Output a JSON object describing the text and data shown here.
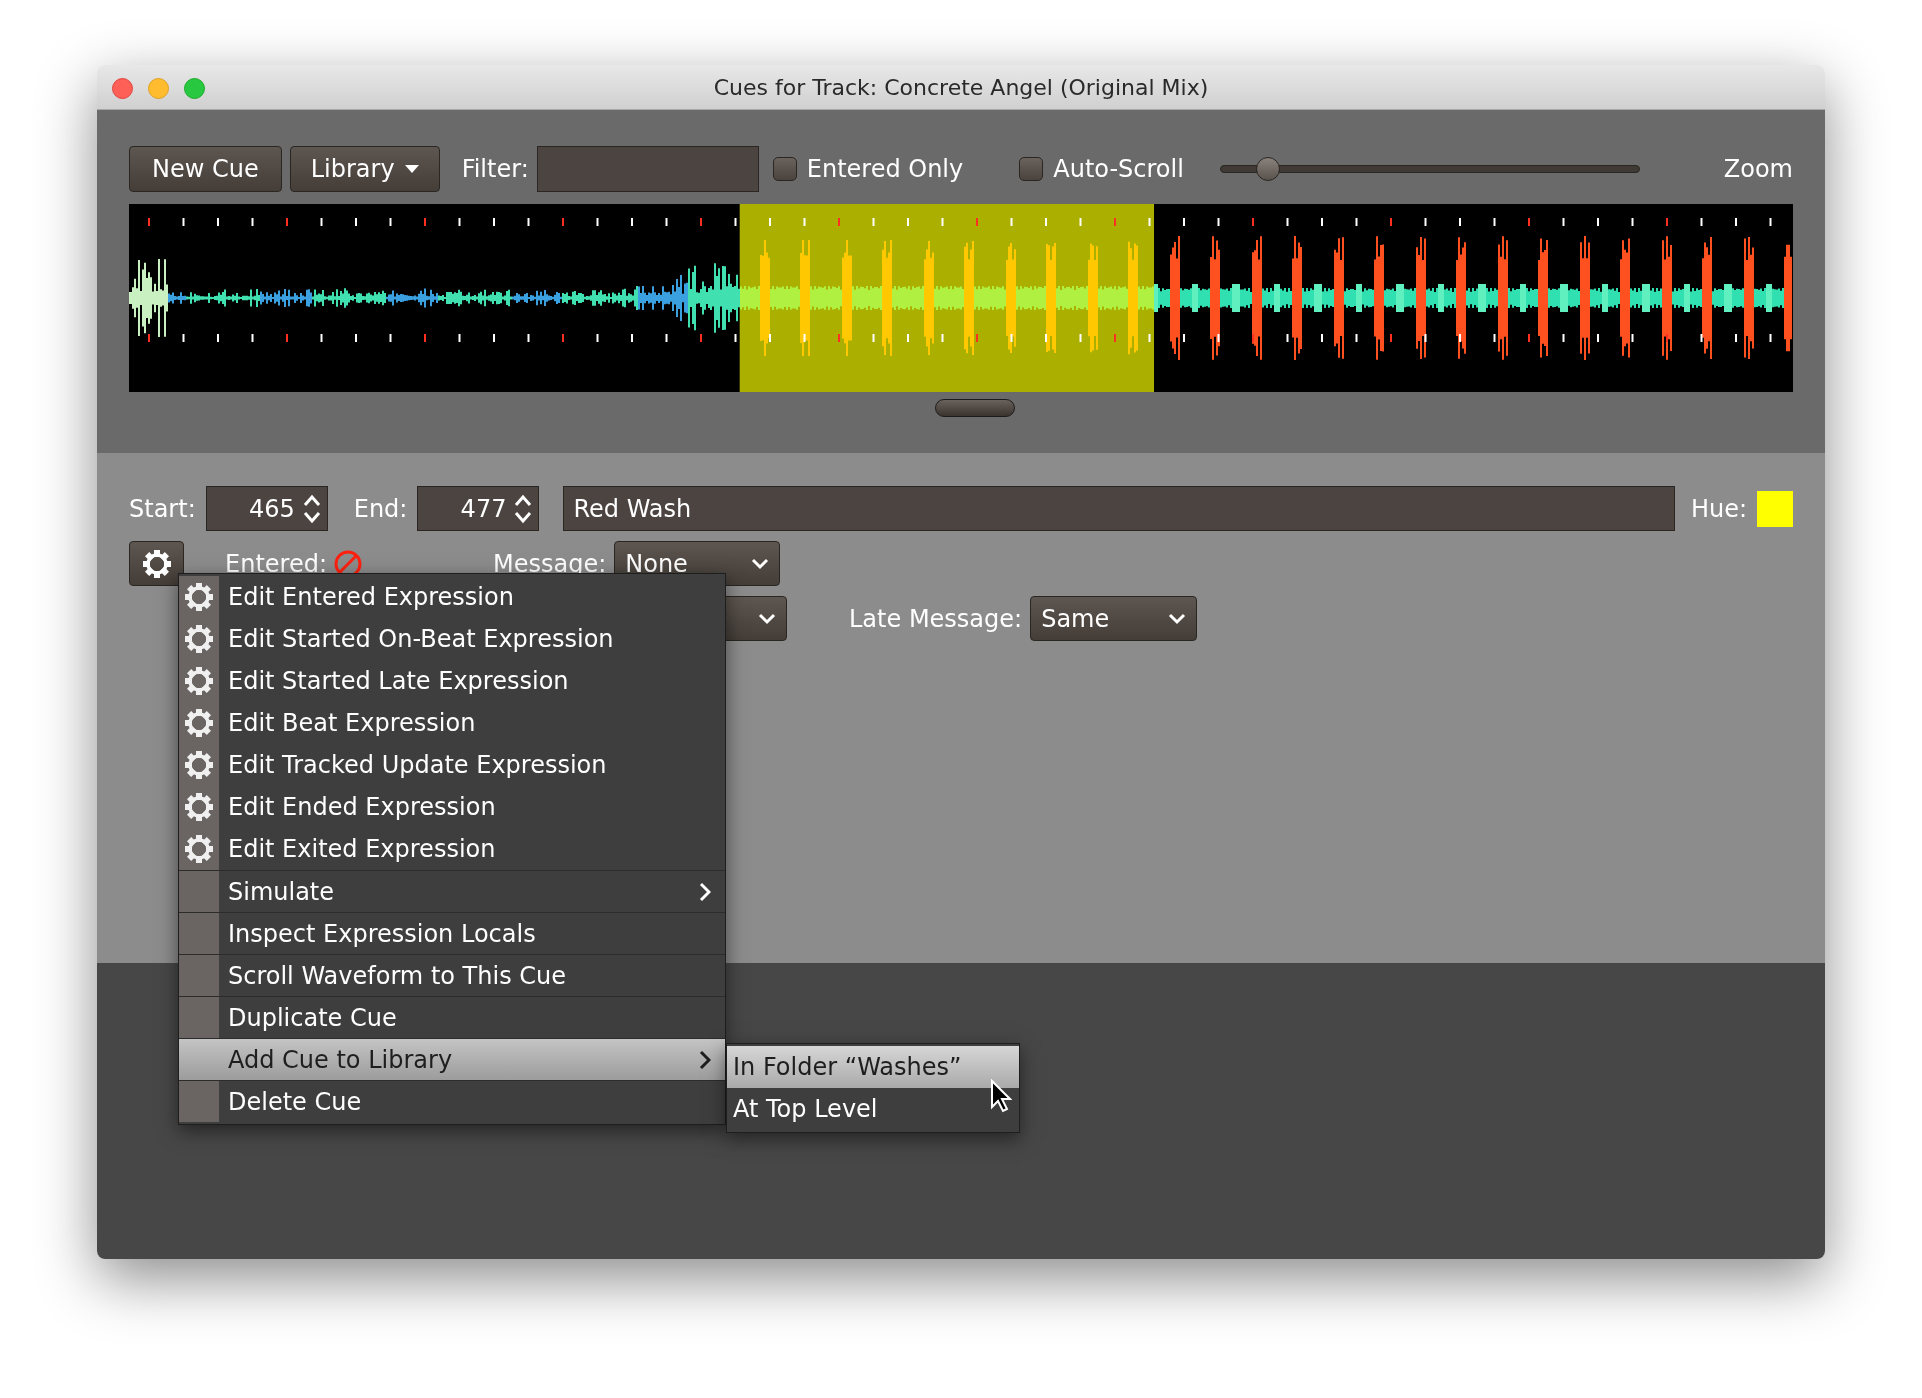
{
  "window": {
    "title": "Cues for Track: Concrete Angel (Original Mix)"
  },
  "toolbar": {
    "new_cue": "New Cue",
    "library": "Library",
    "filter_label": "Filter:",
    "checkboxes": [
      {
        "label": "Entered Only",
        "checked": false
      },
      {
        "label": "Auto-Scroll",
        "checked": false
      }
    ],
    "zoom": {
      "level": 0.09,
      "label": "Zoom"
    }
  },
  "cue": {
    "start_label": "Start:",
    "start": "465",
    "end_label": "End:",
    "end": "477",
    "name": "Red Wash",
    "hue": {
      "label": "Hue:",
      "color": "#ffff00"
    },
    "entered_label": "Entered:",
    "entered": false,
    "message_label": "Message:",
    "message": "None",
    "late_message_label": "Late Message:",
    "late_message": "Same"
  },
  "context_menu": [
    {
      "kind": "gear",
      "label": "Edit Entered Expression",
      "selected": false
    },
    {
      "kind": "gear",
      "label": "Edit Started On-Beat Expression",
      "selected": false
    },
    {
      "kind": "gear",
      "label": "Edit Started Late Expression",
      "selected": false
    },
    {
      "kind": "gear",
      "label": "Edit Beat Expression",
      "selected": false
    },
    {
      "kind": "gear",
      "label": "Edit Tracked Update Expression",
      "selected": false
    },
    {
      "kind": "gear",
      "label": "Edit Ended Expression",
      "selected": false
    },
    {
      "kind": "gear",
      "label": "Edit Exited Expression",
      "selected": false
    },
    {
      "kind": "submenu",
      "label": "Simulate",
      "selected": false
    },
    {
      "kind": "plain",
      "label": "Inspect Expression Locals",
      "selected": false
    },
    {
      "kind": "plain",
      "label": "Scroll Waveform to This Cue",
      "selected": false
    },
    {
      "kind": "plain",
      "label": "Duplicate Cue",
      "selected": false
    },
    {
      "kind": "submenu",
      "label": "Add Cue to Library",
      "selected": true
    },
    {
      "kind": "plain",
      "label": "Delete Cue",
      "selected": false
    }
  ],
  "submenu": [
    {
      "label": "In Folder “Washes”",
      "selected": true
    },
    {
      "label": "At Top Level",
      "selected": false
    }
  ]
}
